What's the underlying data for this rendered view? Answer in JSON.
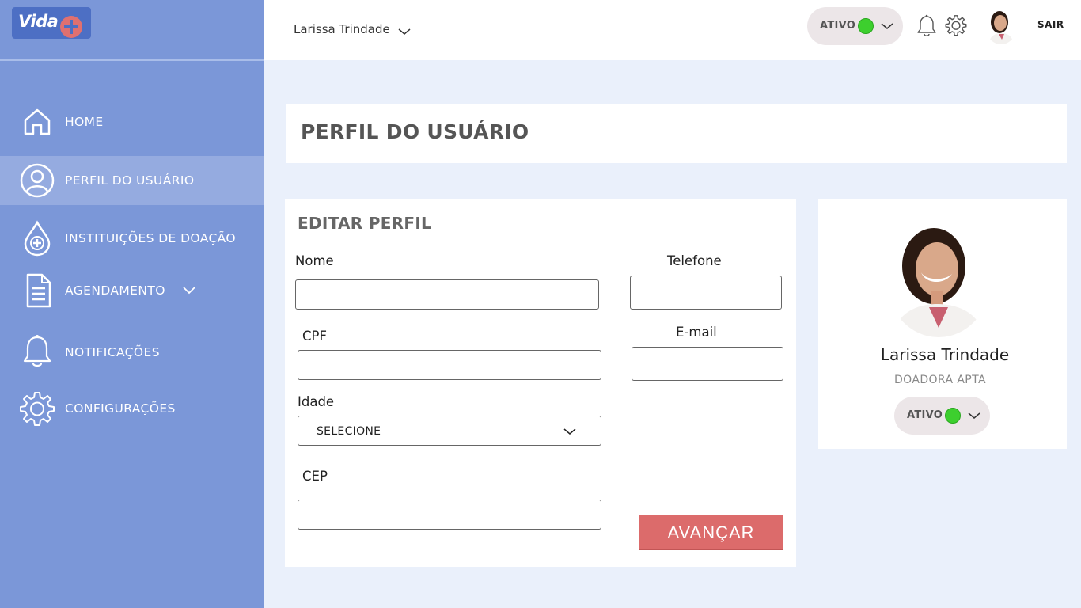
{
  "app": {
    "logo_text": "Vida"
  },
  "header": {
    "user_name": "Larissa Trindade",
    "status_label": "ATIVO",
    "status_color": "#3dcf2e",
    "logout_label": "SAIR"
  },
  "sidebar": {
    "items": [
      {
        "label": "HOME",
        "icon": "home-icon"
      },
      {
        "label": "PERFIL DO USUÁRIO",
        "icon": "user-icon",
        "active": true
      },
      {
        "label": "INSTITUIÇÕES DE DOAÇÃO",
        "icon": "blood-drop-icon"
      },
      {
        "label": "AGENDAMENTO",
        "icon": "document-icon"
      },
      {
        "label": "NOTIFICAÇÕES",
        "icon": "bell-icon"
      },
      {
        "label": "CONFIGURAÇÕES",
        "icon": "gear-icon"
      }
    ]
  },
  "page": {
    "title": "PERFIL DO USUÁRIO"
  },
  "form": {
    "title": "EDITAR PERFIL",
    "fields": {
      "nome": {
        "label": "Nome",
        "value": ""
      },
      "telefone": {
        "label": "Telefone",
        "value": ""
      },
      "cpf": {
        "label": "CPF",
        "value": ""
      },
      "email": {
        "label": "E-mail",
        "value": ""
      },
      "idade": {
        "label": "Idade",
        "selected": "SELECIONE"
      },
      "cep": {
        "label": "CEP",
        "value": ""
      }
    },
    "submit_label": "AVANÇAR"
  },
  "profile": {
    "name": "Larissa Trindade",
    "role": "DOADORA APTA",
    "status_label": "ATIVO"
  },
  "colors": {
    "sidebar": "#7b97d8",
    "sidebar_active": "#95abe0",
    "background": "#eaf0fb",
    "primary_button": "#dc6b6b",
    "status_active": "#3dcf2e"
  }
}
